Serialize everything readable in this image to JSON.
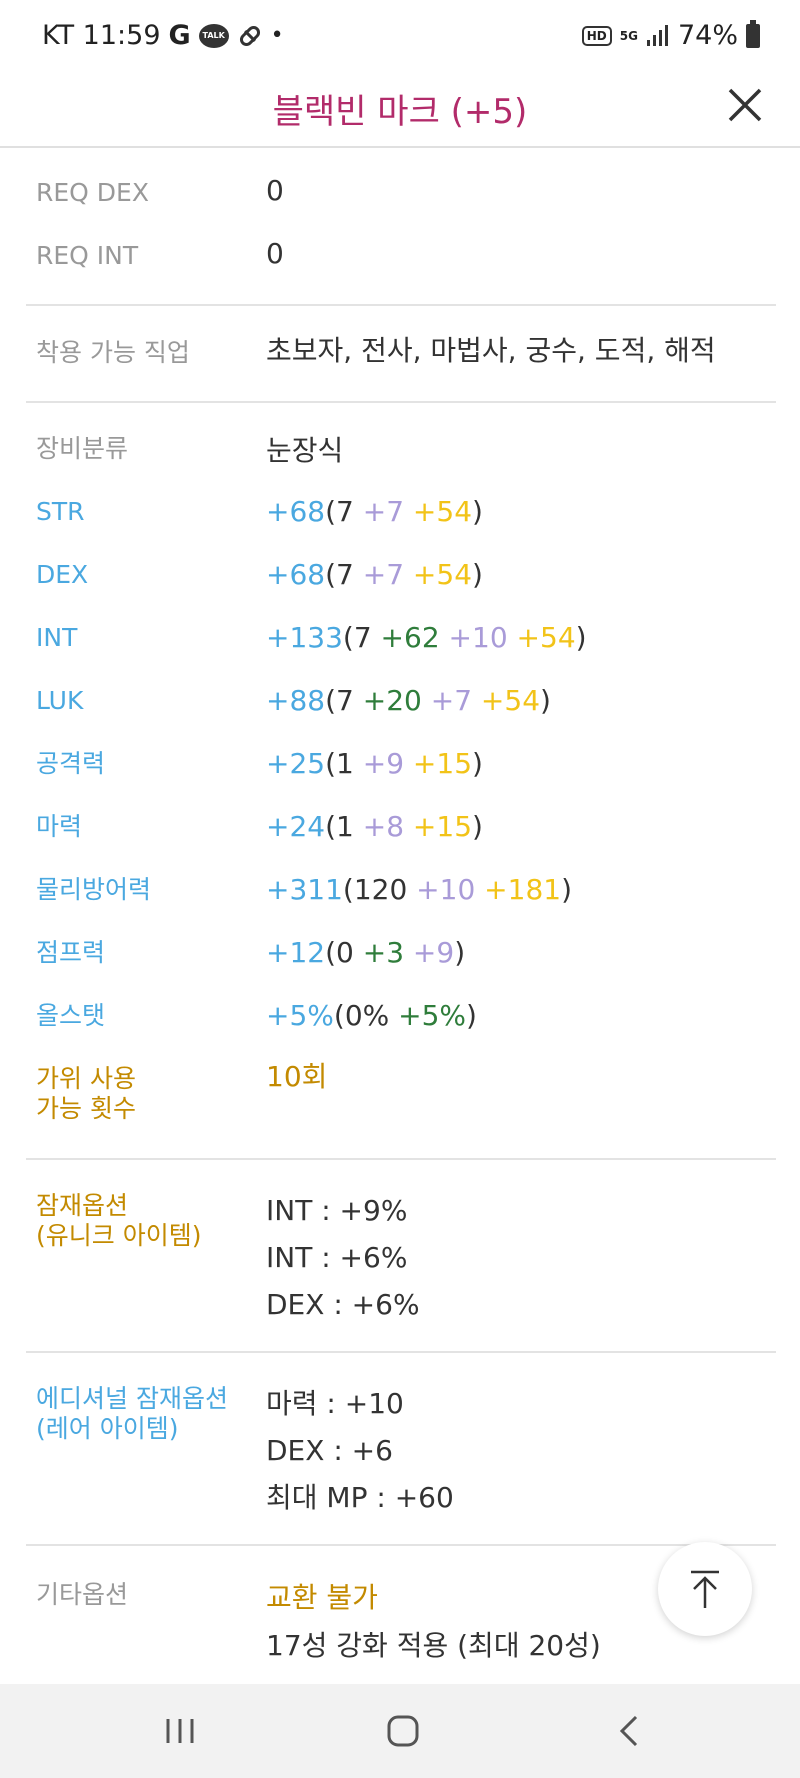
{
  "status_bar": {
    "carrier_time": "KT 11:59",
    "g": "G",
    "talk": "TALK",
    "dot": "•",
    "hd": "HD",
    "fiveg": "5G",
    "battery": "74%"
  },
  "header": {
    "title": "블랙빈 마크 (+5)"
  },
  "rows": {
    "req_dex": {
      "label": "REQ DEX",
      "value": "0"
    },
    "req_int": {
      "label": "REQ INT",
      "value": "0"
    },
    "job": {
      "label": "착용 가능 직업",
      "value": "초보자, 전사, 마법사, 궁수, 도적, 해적"
    },
    "category": {
      "label": "장비분류",
      "value": "눈장식"
    },
    "str": {
      "label": "STR",
      "total": "+68",
      "base": "(7",
      "star": " +7",
      "scroll": " +54",
      "close": ")"
    },
    "dex": {
      "label": "DEX",
      "total": "+68",
      "base": "(7",
      "star": " +7",
      "scroll": " +54",
      "close": ")"
    },
    "int": {
      "label": "INT",
      "total": "+133",
      "base": "(7",
      "add": " +62",
      "star": " +10",
      "scroll": " +54",
      "close": ")"
    },
    "luk": {
      "label": "LUK",
      "total": "+88",
      "base": "(7",
      "add": " +20",
      "star": " +7",
      "scroll": " +54",
      "close": ")"
    },
    "atk": {
      "label": "공격력",
      "total": "+25",
      "base": "(1",
      "star": " +9",
      "scroll": " +15",
      "close": ")"
    },
    "matk": {
      "label": "마력",
      "total": "+24",
      "base": "(1",
      "star": " +8",
      "scroll": " +15",
      "close": ")"
    },
    "def": {
      "label": "물리방어력",
      "total": "+311",
      "base": "(120",
      "star": " +10",
      "scroll": " +181",
      "close": ")"
    },
    "jump": {
      "label": "점프력",
      "total": "+12",
      "base": "(0",
      "add": " +3",
      "star": " +9",
      "close": ")"
    },
    "allstat": {
      "label": "올스탯",
      "total": "+5%",
      "base": "(0%",
      "add": " +5%",
      "close": ")"
    },
    "scissors": {
      "label_1": "가위 사용",
      "label_2": "가능 횟수",
      "value": "10회"
    },
    "potential": {
      "label_1": "잠재옵션",
      "label_2": "(유니크 아이템)",
      "lines": [
        "INT : +9%",
        "INT : +6%",
        "DEX : +6%"
      ]
    },
    "additional": {
      "label_1": "에디셔널 잠재옵션",
      "label_2": "(레어 아이템)",
      "lines": [
        "마력 : +10",
        "DEX : +6",
        "최대 MP : +60"
      ]
    },
    "etc": {
      "label": "기타옵션",
      "line_1": "교환 불가",
      "line_2": "17성 강화 적용 (최대 20성)"
    }
  },
  "colors": {
    "title": "#b22b6a",
    "stat_label": "#4aa8e0",
    "special_label": "#c38a00",
    "green": "#2f7d3b",
    "lilac": "#a99bd8",
    "gold": "#f2c318"
  },
  "icons": {
    "close": "close-icon",
    "scroll_top": "arrow-up-icon",
    "nav_recent": "recent-apps-icon",
    "nav_home": "home-icon",
    "nav_back": "back-icon"
  }
}
